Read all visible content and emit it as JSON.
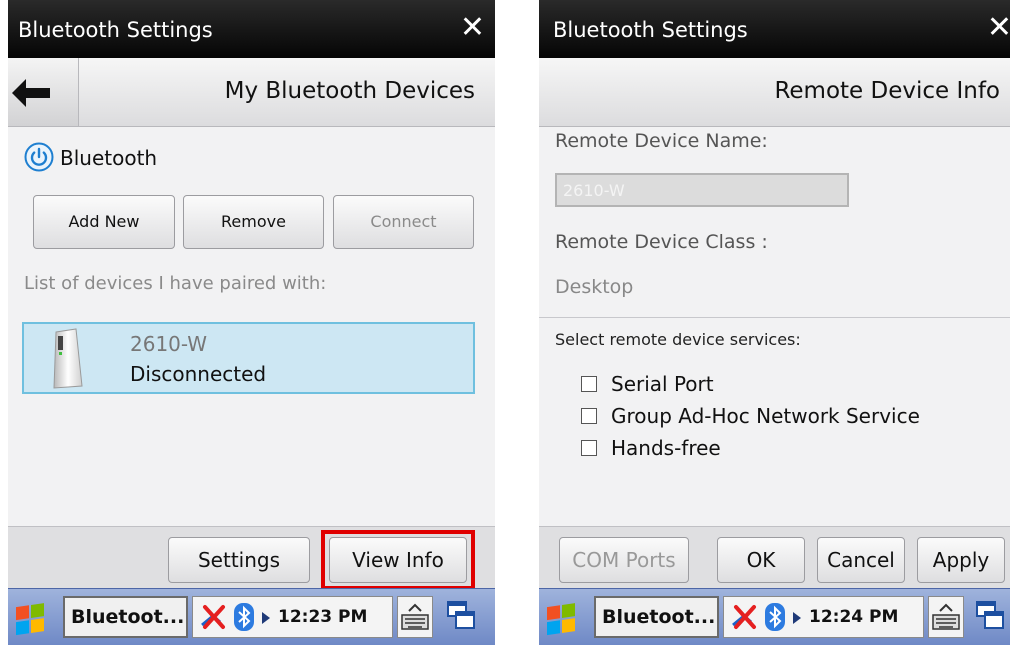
{
  "screen1": {
    "window_title": "Bluetooth Settings",
    "close_glyph": "✕",
    "header_title": "My Bluetooth Devices",
    "bluetooth_label": "Bluetooth",
    "buttons": {
      "add_new": "Add New",
      "remove": "Remove",
      "connect": "Connect"
    },
    "list_caption": "List of devices I have paired with:",
    "device": {
      "name": "2610-W",
      "status": "Disconnected"
    },
    "footer": {
      "settings": "Settings",
      "view_info": "View Info"
    },
    "taskbar": {
      "app": "Bluetoot...",
      "time": "12:23 PM"
    }
  },
  "screen2": {
    "window_title": "Bluetooth Settings",
    "close_glyph": "✕",
    "header_title": "Remote Device Info",
    "name_label": "Remote Device Name:",
    "name_value": "2610-W",
    "class_label": "Remote Device Class :",
    "class_value": "Desktop",
    "services_label": "Select remote device services:",
    "services": [
      "Serial Port",
      "Group Ad-Hoc Network Service",
      "Hands-free"
    ],
    "buttons": {
      "com_ports": "COM Ports",
      "ok": "OK",
      "cancel": "Cancel",
      "apply": "Apply"
    },
    "taskbar": {
      "app": "Bluetoot...",
      "time": "12:24 PM"
    }
  },
  "colors": {
    "selection": "#cde7f3",
    "selection_border": "#6fc0df",
    "highlight_box": "#e00000",
    "power_icon": "#1e7fd0"
  }
}
